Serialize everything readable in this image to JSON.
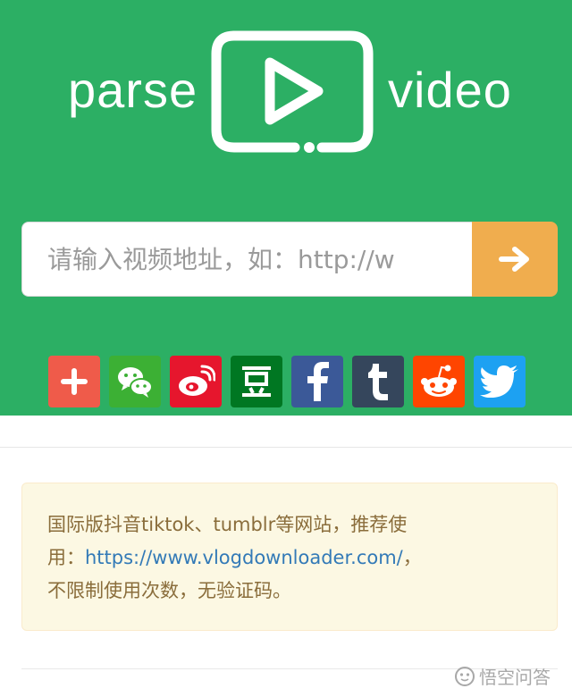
{
  "header": {
    "logo_left": "parse",
    "logo_right": "video",
    "logo_icon": "play-video-icon"
  },
  "search": {
    "placeholder": "请输入视频地址，如：http://w",
    "submit_icon": "arrow-right-icon"
  },
  "share": {
    "items": [
      {
        "name": "plus",
        "color": "#ef5b4a"
      },
      {
        "name": "wechat",
        "color": "#3cb034"
      },
      {
        "name": "weibo",
        "color": "#e6162d"
      },
      {
        "name": "douban",
        "color": "#007722"
      },
      {
        "name": "facebook",
        "color": "#3b5998"
      },
      {
        "name": "tumblr",
        "color": "#35465c"
      },
      {
        "name": "reddit",
        "color": "#ff4500"
      },
      {
        "name": "twitter",
        "color": "#1da1f2"
      }
    ]
  },
  "notice": {
    "line1": "国际版抖音tiktok、tumblr等网站，推荐使",
    "line2_prefix": "用：",
    "link": "https://www.vlogdownloader.com/",
    "line2_suffix": "，",
    "line3": "不限制使用次数，无验证码。"
  },
  "watermark": {
    "text": "悟空问答"
  },
  "colors": {
    "hero_bg": "#2caf64",
    "button_bg": "#f0ad4e",
    "notice_bg": "#fcf8e3",
    "notice_text": "#8a6d3b",
    "link": "#337ab7"
  }
}
